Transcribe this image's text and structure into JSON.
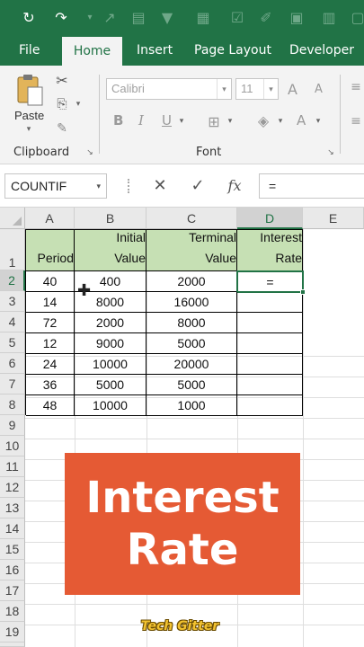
{
  "quick_access": {
    "icons": [
      "autosave-icon",
      "redo-icon",
      "chart-icon",
      "table-icon",
      "filter-icon",
      "form-icon",
      "check-icon",
      "table2-icon",
      "sort-icon"
    ]
  },
  "ribbon_tabs": {
    "file": "File",
    "home": "Home",
    "insert": "Insert",
    "page_layout": "Page Layout",
    "developer": "Developer"
  },
  "ribbon": {
    "paste_label": "Paste",
    "clipboard_label": "Clipboard",
    "font_label": "Font",
    "font_name": "Calibri",
    "font_size": "11",
    "bold": "B",
    "italic": "I",
    "underline": "U",
    "grow_font": "A",
    "shrink_font": "A",
    "font_color": "A"
  },
  "formula_bar": {
    "name_box": "COUNTIF",
    "cancel": "✕",
    "enter": "✓",
    "fx": "fx",
    "formula": "="
  },
  "columns": [
    "A",
    "B",
    "C",
    "D",
    "E"
  ],
  "rows": [
    "1",
    "2",
    "3",
    "4",
    "5",
    "6",
    "7",
    "8",
    "9",
    "10",
    "11",
    "12",
    "13",
    "14",
    "15",
    "16",
    "17",
    "18",
    "19",
    "20"
  ],
  "table": {
    "headers": {
      "period": "Period",
      "initial_line1": "Initial",
      "initial_line2": "Value",
      "terminal_line1": "Terminal",
      "terminal_line2": "Value",
      "rate_line1": "Interest",
      "rate_line2": "Rate"
    },
    "rows": [
      {
        "period": "40",
        "initial": "400",
        "terminal": "2000",
        "rate": "="
      },
      {
        "period": "14",
        "initial": "8000",
        "terminal": "16000",
        "rate": ""
      },
      {
        "period": "72",
        "initial": "2000",
        "terminal": "8000",
        "rate": ""
      },
      {
        "period": "12",
        "initial": "9000",
        "terminal": "5000",
        "rate": ""
      },
      {
        "period": "24",
        "initial": "10000",
        "terminal": "20000",
        "rate": ""
      },
      {
        "period": "36",
        "initial": "5000",
        "terminal": "5000",
        "rate": ""
      },
      {
        "period": "48",
        "initial": "10000",
        "terminal": "1000",
        "rate": ""
      }
    ]
  },
  "banner": {
    "line1": "Interest",
    "line2": "Rate"
  },
  "watermark": "Tech Gitter",
  "colors": {
    "excel_green": "#217346",
    "header_fill": "#c6e0b4",
    "banner_bg": "#e55a34"
  }
}
